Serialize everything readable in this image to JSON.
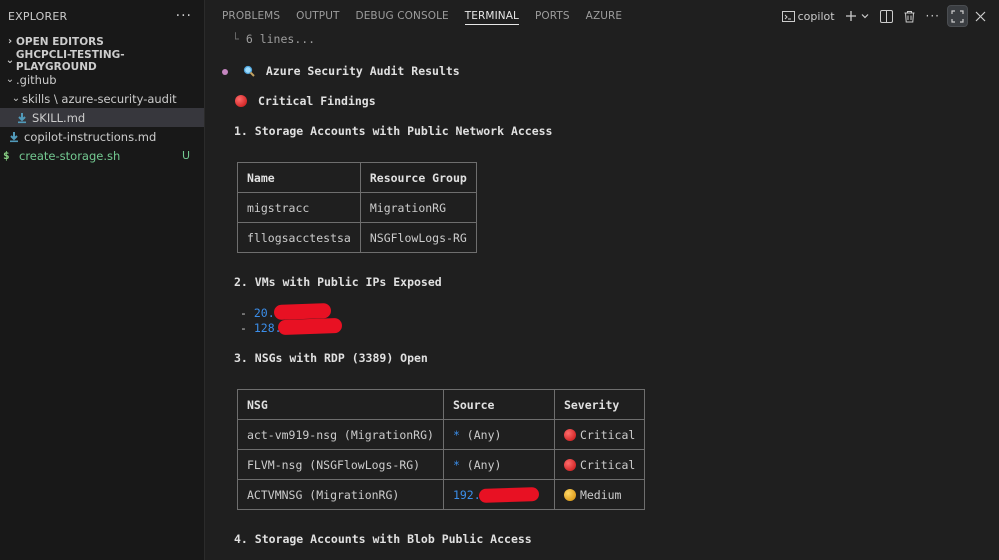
{
  "sidebar": {
    "title": "EXPLORER",
    "more_icon": "ellipsis-icon",
    "open_editors": "OPEN EDITORS",
    "workspace": "GHCPCLI-TESTING-PLAYGROUND",
    "tree": {
      "github_folder": ".github",
      "skills_path": "skills \\ azure-security-audit",
      "skill_file": "SKILL.md",
      "copilot_file": "copilot-instructions.md",
      "storage_script": "create-storage.sh",
      "storage_badge": "U"
    }
  },
  "panel": {
    "tabs": [
      "PROBLEMS",
      "OUTPUT",
      "DEBUG CONSOLE",
      "TERMINAL",
      "PORTS",
      "AZURE"
    ],
    "active_tab": "TERMINAL",
    "terminal_name": "copilot"
  },
  "terminal": {
    "collapsed_lines": "6 lines...",
    "heading": "Azure Security Audit Results",
    "critical_heading": "Critical Findings",
    "section1": "1. Storage Accounts with Public Network Access",
    "table1": {
      "headers": [
        "Name",
        "Resource Group"
      ],
      "rows": [
        [
          "migstracc",
          "MigrationRG"
        ],
        [
          "fllogsacctestsa",
          "NSGFlowLogs-RG"
        ]
      ]
    },
    "section2": "2. VMs with Public IPs Exposed",
    "ips": [
      {
        "dash": "- ",
        "value": "20."
      },
      {
        "dash": "- ",
        "value": "128."
      }
    ],
    "section3": "3. NSGs with RDP (3389) Open",
    "table3": {
      "headers": [
        "NSG",
        "Source",
        "Severity"
      ],
      "rows": [
        {
          "nsg": "act-vm919-nsg (MigrationRG)",
          "source_star": "*",
          "source_text": " (Any)",
          "severity": "Critical"
        },
        {
          "nsg": "FLVM-nsg (NSGFlowLogs-RG)",
          "source_star": "*",
          "source_text": " (Any)",
          "severity": "Critical"
        },
        {
          "nsg": "ACTVMNSG (MigrationRG)",
          "source_star": "192.",
          "source_text": "",
          "severity": "Medium"
        }
      ]
    },
    "section4": "4. Storage Accounts with Blob Public Access"
  },
  "colors": {
    "critical": "#d42a2a",
    "medium": "#e0a020",
    "link_blue": "#3b8eea",
    "untracked_green": "#73c991"
  }
}
